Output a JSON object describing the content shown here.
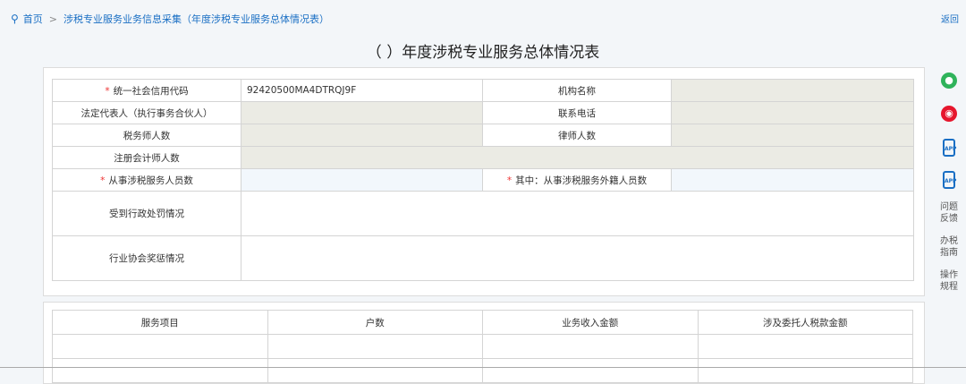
{
  "breadcrumb": {
    "home": "首页",
    "separator": ">",
    "current": "涉税专业服务业务信息采集（年度涉税专业服务总体情况表）"
  },
  "back_label": "返回",
  "page_title": "（ ）年度涉税专业服务总体情况表",
  "form": {
    "credit_code_label": "统一社会信用代码",
    "credit_code_value": "92420500MA4DTRQJ9F",
    "org_name_label": "机构名称",
    "legal_rep_label": "法定代表人（执行事务合伙人）",
    "phone_label": "联系电话",
    "tax_agents_label": "税务师人数",
    "lawyers_label": "律师人数",
    "cpa_label": "注册会计师人数",
    "staff_label": "从事涉税服务人员数",
    "foreign_staff_label": "其中：从事涉税服务外籍人员数",
    "penalty_label": "受到行政处罚情况",
    "award_label": "行业协会奖惩情况"
  },
  "stats_table": {
    "headers": [
      "服务项目",
      "户数",
      "业务收入金额",
      "涉及委托人税款金额"
    ]
  },
  "sidebar": {
    "wechat_icon": "wechat-icon",
    "weibo_icon": "weibo-icon",
    "app_glyph": "APP",
    "feedback": [
      "问题",
      "反馈"
    ],
    "guide": [
      "办税",
      "指南"
    ],
    "rules": [
      "操作",
      "规程"
    ]
  },
  "colors": {
    "link": "#1a6fc4",
    "required": "#e33333",
    "readonly_bg": "#ebebe4",
    "wechat": "#2fb35b",
    "weibo": "#e6162d"
  }
}
